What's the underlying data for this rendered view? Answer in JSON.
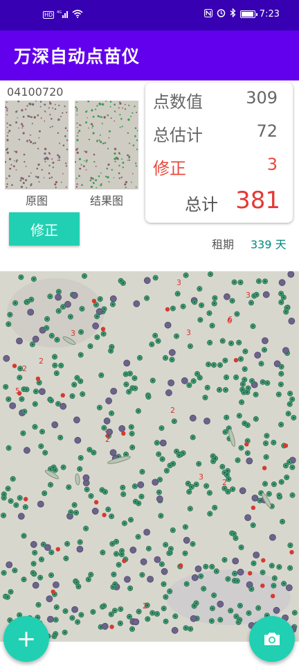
{
  "status_bar": {
    "hd_badge": "HD",
    "network": "4G",
    "time": "7:23",
    "icons": [
      "hd-badge",
      "signal-icon",
      "wifi-icon",
      "nfc-icon",
      "alarm-icon",
      "bluetooth-icon",
      "battery-icon"
    ]
  },
  "app": {
    "title": "万深自动点苗仪"
  },
  "sample": {
    "code": "04100720"
  },
  "images": {
    "original_label": "原图",
    "result_label": "结果图"
  },
  "buttons": {
    "fix_label": "修正",
    "add_symbol": "+"
  },
  "stats": {
    "dot_count_label": "点数值",
    "dot_count_value": "309",
    "estimate_label": "总估计",
    "estimate_value": "72",
    "correction_label": "修正",
    "correction_value": "3",
    "total_label": "总计",
    "total_value": "381"
  },
  "period": {
    "label": "租期",
    "value": "339 天"
  },
  "micrograph_numbers": [
    "3",
    "3",
    "3",
    "6",
    "2",
    "3",
    "2",
    "5",
    "2",
    "2",
    "6",
    "3",
    "2",
    "2",
    "2"
  ],
  "colors": {
    "status_bar": "#3700b3",
    "app_bar": "#6200ee",
    "accent": "#21d0b2",
    "total_red": "#e53935",
    "period_teal": "#00897b"
  }
}
